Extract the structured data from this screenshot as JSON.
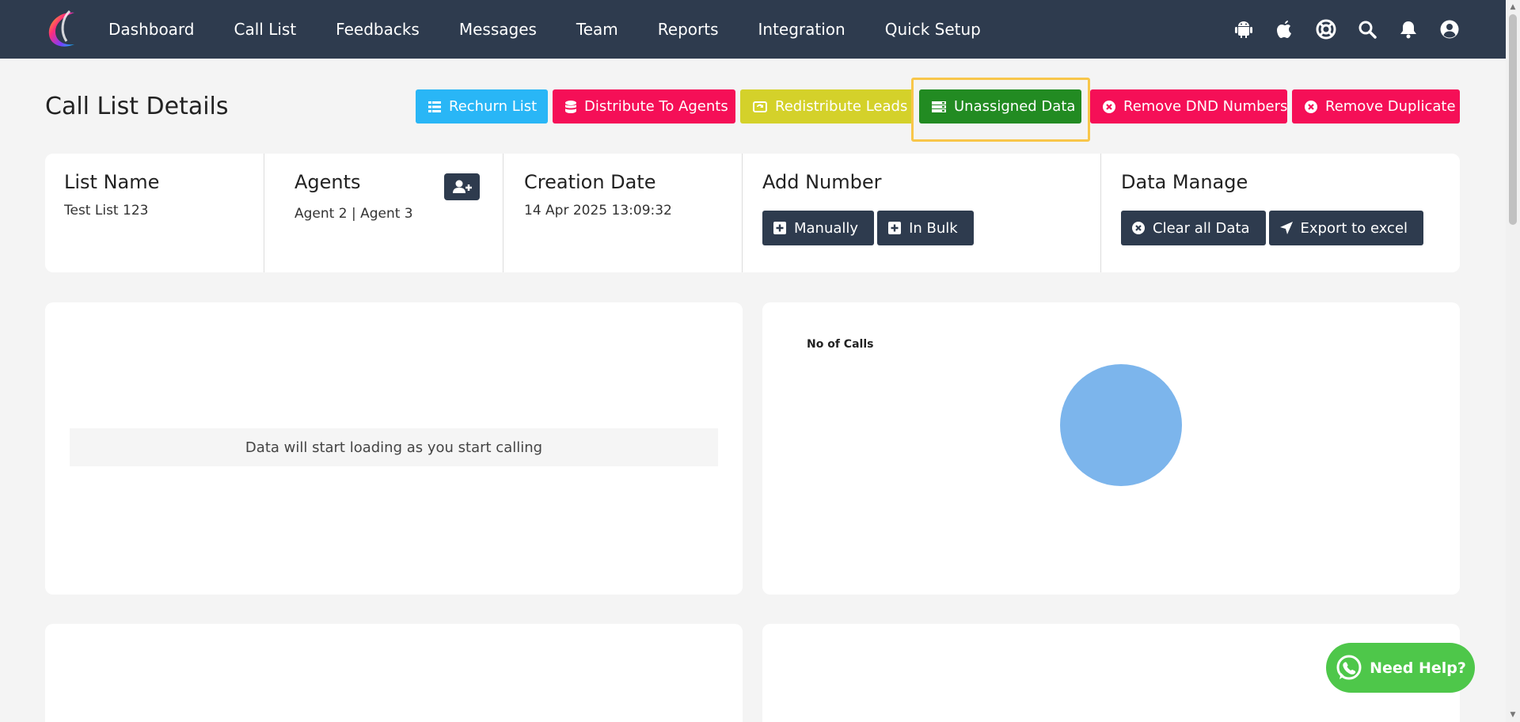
{
  "nav": {
    "items": [
      {
        "label": "Dashboard"
      },
      {
        "label": "Call List"
      },
      {
        "label": "Feedbacks"
      },
      {
        "label": "Messages"
      },
      {
        "label": "Team"
      },
      {
        "label": "Reports"
      },
      {
        "label": "Integration"
      },
      {
        "label": "Quick Setup"
      }
    ],
    "icons": [
      "android-icon",
      "apple-icon",
      "support-icon",
      "search-icon",
      "bell-icon",
      "user-circle-icon"
    ]
  },
  "page": {
    "title": "Call List Details"
  },
  "actions": {
    "rechurn": "Rechurn List",
    "distribute": "Distribute To Agents",
    "redistribute": "Redistribute Leads",
    "unassigned": "Unassigned Data",
    "remove_dnd": "Remove DND Numbers",
    "remove_duplicate": "Remove Duplicate"
  },
  "info": {
    "list_name": {
      "title": "List Name",
      "value": "Test List 123"
    },
    "agents": {
      "title": "Agents",
      "value": "Agent 2 | Agent 3"
    },
    "creation_date": {
      "title": "Creation Date",
      "value": "14 Apr 2025 13:09:32"
    },
    "add_number": {
      "title": "Add Number",
      "manually": "Manually",
      "in_bulk": "In Bulk"
    },
    "data_manage": {
      "title": "Data Manage",
      "clear": "Clear all Data",
      "export": "Export to excel"
    }
  },
  "panels": {
    "empty_message": "Data will start loading as you start calling"
  },
  "chart_data": {
    "type": "pie",
    "title": "No of Calls",
    "values": [
      1
    ],
    "colors": [
      "#7cb5ec"
    ]
  },
  "help": {
    "label": "Need Help?"
  },
  "colors": {
    "nav_bg": "#2e3b4e",
    "cyan": "#29b6f6",
    "pink": "#f50f57",
    "yellow": "#d4d12a",
    "green": "#228b22",
    "highlight": "#f8c64a",
    "help_green": "#4ec74a"
  }
}
